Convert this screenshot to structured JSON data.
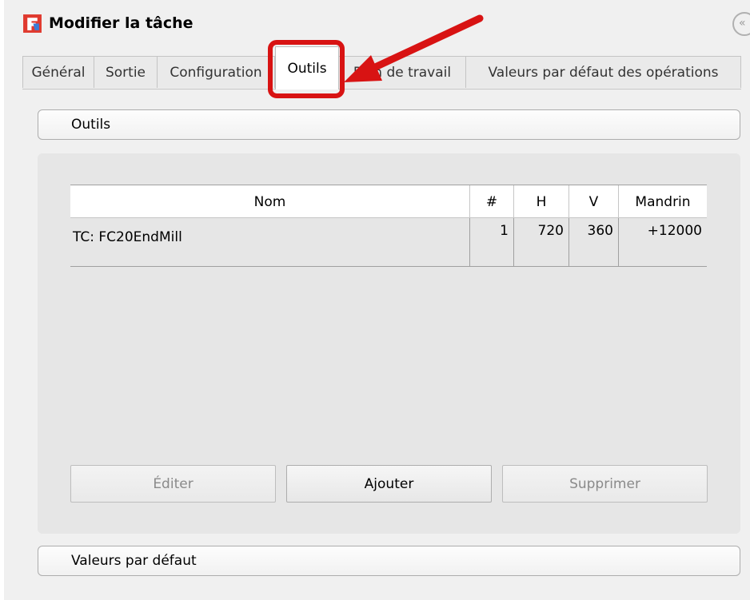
{
  "window": {
    "title": "Modifier la tâche"
  },
  "tabs": [
    {
      "label": "Général"
    },
    {
      "label": "Sortie"
    },
    {
      "label": "Configuration"
    },
    {
      "label": "Outils",
      "active": true
    },
    {
      "label": "Plan de travail"
    },
    {
      "label": "Valeurs par défaut des opérations"
    }
  ],
  "sections": {
    "tools_header": "Outils",
    "defaults_header": "Valeurs par défaut"
  },
  "table": {
    "columns": [
      "Nom",
      "#",
      "H",
      "V",
      "Mandrin"
    ],
    "rows": [
      {
        "name": "TC: FC20EndMill",
        "number": "1",
        "h": "720",
        "v": "360",
        "spindle": "+12000"
      }
    ]
  },
  "buttons": {
    "edit": "Éditer",
    "add": "Ajouter",
    "delete": "Supprimer"
  },
  "colors": {
    "highlight": "#d81313",
    "accent_icon": "#e03a2f",
    "accent_icon_secondary": "#3a7dd8"
  },
  "icons": {
    "app": "freecad-icon",
    "collapse": "collapse-icon",
    "annotation": "red-arrow-icon"
  }
}
